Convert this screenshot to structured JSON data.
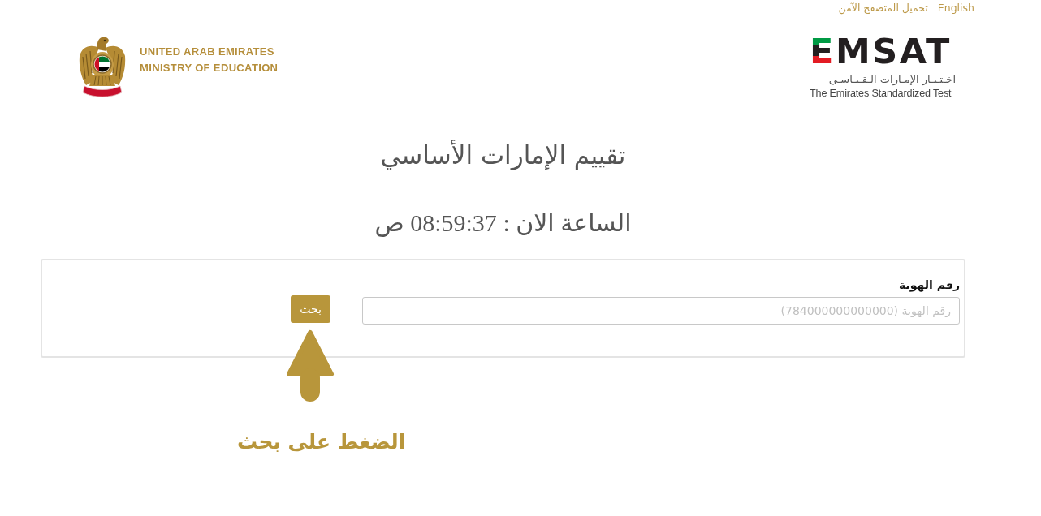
{
  "top_links": [
    {
      "label": "English"
    },
    {
      "label": "تحميل المتصفح الآمن"
    }
  ],
  "header": {
    "ministry": {
      "line_1": "UNITED ARAB EMIRATES",
      "line_2": "MINISTRY OF EDUCATION"
    },
    "exam_logo": {
      "wordmark": "EMSAT",
      "arabic_name": "اخـتـبـار الإمـارات الـقـيـاسـي",
      "english_name": "The Emirates Standardized Test"
    }
  },
  "page_title": "تقييم الإمارات الأساسي",
  "clock": "الساعة الان : 08:59:37 ص",
  "search_form": {
    "label": "رقم الهوية",
    "field": {
      "placeholder": "رقم الهوية (784000000000000)"
    },
    "button": "بحث"
  },
  "hint": "الضغط على بحث"
}
